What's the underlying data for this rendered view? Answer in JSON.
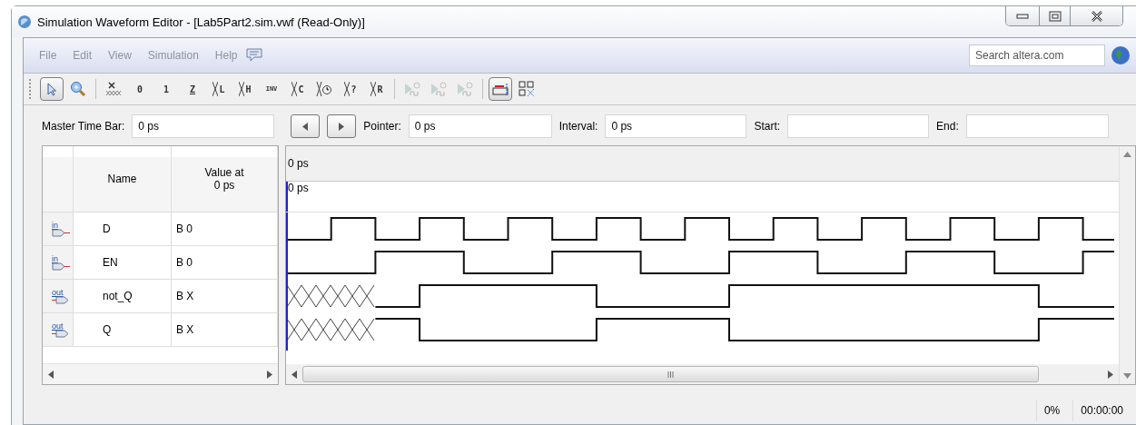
{
  "window": {
    "title": "Simulation Waveform Editor - [Lab5Part2.sim.vwf (Read-Only)]"
  },
  "menu": [
    "File",
    "Edit",
    "View",
    "Simulation",
    "Help"
  ],
  "search": {
    "placeholder": "Search altera.com"
  },
  "toolbar": [
    {
      "kind": "pointer",
      "selected": true,
      "disabled": false
    },
    {
      "kind": "zoom",
      "selected": false,
      "disabled": false
    },
    {
      "kind": "sep"
    },
    {
      "kind": "unknown",
      "selected": false,
      "disabled": false
    },
    {
      "kind": "low",
      "glyph": "0",
      "selected": false,
      "disabled": false
    },
    {
      "kind": "high",
      "glyph": "1",
      "selected": false,
      "disabled": false
    },
    {
      "kind": "bar",
      "glyph": "Z",
      "selected": false,
      "disabled": false
    },
    {
      "kind": "cross",
      "glyph": "L",
      "selected": false,
      "disabled": false
    },
    {
      "kind": "cross",
      "glyph": "H",
      "selected": false,
      "disabled": false
    },
    {
      "kind": "stack",
      "glyph": "INV",
      "selected": false,
      "disabled": false
    },
    {
      "kind": "cross",
      "glyph": "C",
      "selected": false,
      "disabled": false
    },
    {
      "kind": "clock",
      "selected": false,
      "disabled": false
    },
    {
      "kind": "cross",
      "glyph": "?",
      "selected": false,
      "disabled": false
    },
    {
      "kind": "cross",
      "glyph": "R",
      "selected": false,
      "disabled": false
    },
    {
      "kind": "sep"
    },
    {
      "kind": "sim",
      "selected": false,
      "disabled": true
    },
    {
      "kind": "sim",
      "selected": false,
      "disabled": true
    },
    {
      "kind": "sim",
      "selected": false,
      "disabled": true
    },
    {
      "kind": "sep"
    },
    {
      "kind": "snap",
      "selected": true,
      "disabled": false
    },
    {
      "kind": "grid",
      "selected": false,
      "disabled": false
    }
  ],
  "time_bar": {
    "master_label": "Master Time Bar:",
    "master_value": "0 ps",
    "pointer_label": "Pointer:",
    "pointer_value": "0 ps",
    "interval_label": "Interval:",
    "interval_value": "0 ps",
    "start_label": "Start:",
    "end_label": "End:"
  },
  "table": {
    "columns": [
      "Name",
      "Value at\n0 ps"
    ],
    "rows": [
      {
        "kind": "input",
        "pin_label": "in",
        "name": "D",
        "value": "B 0"
      },
      {
        "kind": "input",
        "pin_label": "in",
        "name": "EN",
        "value": "B 0"
      },
      {
        "kind": "output",
        "pin_label": "out",
        "name": "not_Q",
        "value": "B X"
      },
      {
        "kind": "output",
        "pin_label": "out",
        "name": "Q",
        "value": "B X"
      }
    ]
  },
  "waveform": {
    "ruler_label": "0 ps",
    "cursor_label": "0 ps"
  },
  "status_bar": {
    "progress": "0%",
    "elapsed": "00:00:00"
  }
}
